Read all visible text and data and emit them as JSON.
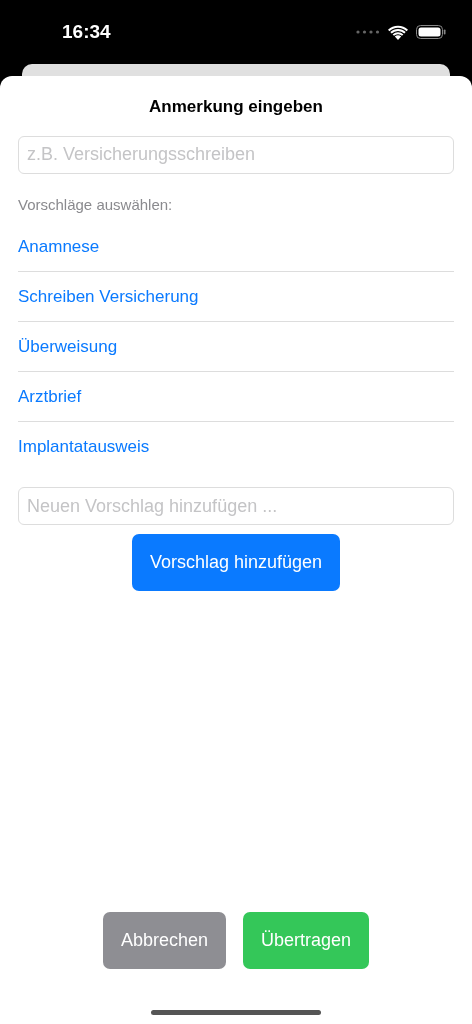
{
  "status_bar": {
    "time": "16:34"
  },
  "sheet": {
    "title": "Anmerkung eingeben",
    "note_field": {
      "placeholder": "z.B. Versicherungsschreiben"
    },
    "suggestions_label": "Vorschläge auswählen:",
    "suggestions": [
      {
        "label": "Anamnese"
      },
      {
        "label": "Schreiben Versicherung"
      },
      {
        "label": "Überweisung"
      },
      {
        "label": "Arztbrief"
      },
      {
        "label": "Implantatausweis"
      }
    ],
    "new_suggestion_field": {
      "placeholder": "Neuen Vorschlag hinzufügen ..."
    },
    "add_button": "Vorschlag hinzufügen",
    "buttons": [
      {
        "label": "Abbrechen",
        "kind": "cancel"
      },
      {
        "label": "Übertragen",
        "kind": "confirm"
      }
    ]
  }
}
